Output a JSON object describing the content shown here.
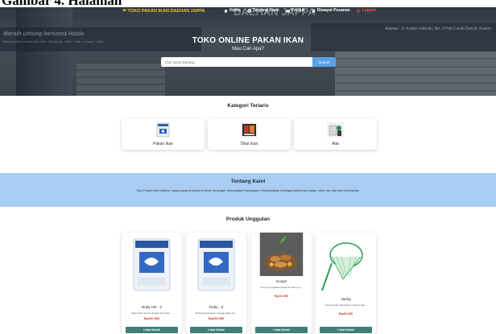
{
  "caption_cropped": "Gambar 4. Halaman",
  "nav": {
    "brand": "TOKO PAKAN IKAN DAEHAN JAPPA",
    "items": [
      {
        "label": "Home",
        "icon": "home-icon"
      },
      {
        "label": "Tentang Kami",
        "icon": "info-icon"
      },
      {
        "label": "Produk",
        "icon": "box-icon"
      },
      {
        "label": "Riwayat Pesanan",
        "icon": "history-icon"
      },
      {
        "label": "Logout",
        "icon": "logout-icon"
      }
    ]
  },
  "hero": {
    "title": "TOKO ONLINE PAKAN IKAN",
    "subtitle": "Mau Cari Apa?",
    "ghost_left": "Meraih untung bersama Haida",
    "ghost_left_sub": "Menyediakan Aneka Ikan Lele · Bandeng · Patin · Nila · Gurami · Mas",
    "ghost_right": "Alamat : Jl. Kraton Industri, No. 2 Plat Curah Dukuh, Kraton",
    "ghost_top": "DAEHAN JAPPA"
  },
  "search": {
    "placeholder": "Cari nama barang...",
    "button_label": "Search"
  },
  "categories": {
    "title": "Kategori Terlaris",
    "items": [
      {
        "label": "Pakan Ikan"
      },
      {
        "label": "Obat Ikan"
      },
      {
        "label": "Alat"
      }
    ]
  },
  "about": {
    "title": "Tentang Kami",
    "text": "Toko Pakan Ikan Daehan Jappa yang berlokasi di Desa Kerangan, Kecamatan Kepolangan. Menyediakan berbagai kebutuhan pakan, obat, dan alat ikan berkualitas."
  },
  "products": {
    "title": "Produk Unggulan",
    "items": [
      {
        "name": "Ruby HG - 2",
        "desc": "Pakan ikan apung dengan formulasi ...",
        "price": "Rp230.000",
        "button": "Lihat Detail"
      },
      {
        "name": "Ruby - 3",
        "desc": "Dirancang dengan menggunakan ba...",
        "price": "Rp235.000",
        "button": "Lihat Detail"
      },
      {
        "name": "Kunyit",
        "desc": "Kunyit merupakan tanaman herba ya...",
        "price": "Rp10.000",
        "button": "Lihat Detail"
      },
      {
        "name": "Jaring",
        "desc": "Jaring (ayak) digunakan untuk mengi...",
        "price": "Rp45.000",
        "button": "Lihat Detail"
      }
    ]
  },
  "colors": {
    "brand_yellow": "#f4c430",
    "search_blue": "#5aa0e6",
    "about_bg": "#a9cdf3",
    "price_red": "#c0392b",
    "button_teal": "#3f7f7a",
    "logout_red": "#ff4d4d"
  }
}
